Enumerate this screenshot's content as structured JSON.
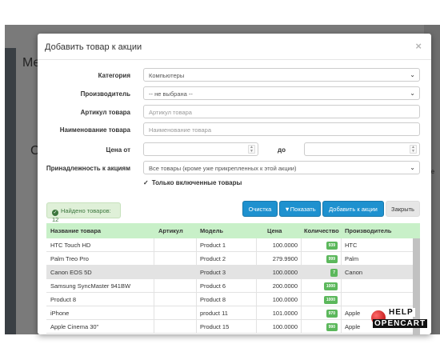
{
  "background": {
    "letter_m": "Ме",
    "letter_c": "С",
    "right_text": "ле"
  },
  "modal": {
    "title": "Добавить товар к акции",
    "close": "×"
  },
  "form": {
    "category_label": "Категория",
    "category_value": "Компьютеры",
    "manufacturer_label": "Производитель",
    "manufacturer_value": "-- не выбрана --",
    "sku_label": "Артикул товара",
    "sku_placeholder": "Артикул товара",
    "name_label": "Наименование товара",
    "name_placeholder": "Наименование товара",
    "price_from_label": "Цена от",
    "price_to_label": "до",
    "belong_label": "Принадлежность к акциям",
    "belong_value": "Все товары (кроме уже прикрепленных к этой акции)",
    "only_enabled": "Только включенные товары"
  },
  "found": "Найдено товаров: 12",
  "buttons": {
    "clear": "Очистка",
    "show": "Показать",
    "add": "Добавить к акции",
    "close": "Закрыть"
  },
  "table": {
    "headers": [
      "Название товара",
      "Артикул",
      "Модель",
      "Цена",
      "Количество",
      "Производитель"
    ],
    "rows": [
      {
        "name": "HTC Touch HD",
        "sku": "",
        "model": "Product 1",
        "price": "100.0000",
        "qty": "939",
        "maker": "HTC"
      },
      {
        "name": "Palm Treo Pro",
        "sku": "",
        "model": "Product 2",
        "price": "279.9900",
        "qty": "999",
        "maker": "Palm"
      },
      {
        "name": "Canon EOS 5D",
        "sku": "",
        "model": "Product 3",
        "price": "100.0000",
        "qty": "7",
        "maker": "Canon"
      },
      {
        "name": "Samsung SyncMaster 941BW",
        "sku": "",
        "model": "Product 6",
        "price": "200.0000",
        "qty": "1000",
        "maker": ""
      },
      {
        "name": "Product 8",
        "sku": "",
        "model": "Product 8",
        "price": "100.0000",
        "qty": "1000",
        "maker": ""
      },
      {
        "name": "iPhone",
        "sku": "",
        "model": "product 11",
        "price": "101.0000",
        "qty": "970",
        "maker": "Apple"
      },
      {
        "name": "Apple Cinema 30\"",
        "sku": "",
        "model": "Product 15",
        "price": "100.0000",
        "qty": "990",
        "maker": "Apple"
      }
    ]
  },
  "logo": {
    "line1": "HELP",
    "line2": "OPENCART"
  },
  "colors": {
    "primary": "#1e91cf",
    "success": "#5cb85c",
    "table_header": "#c8f0c8"
  }
}
